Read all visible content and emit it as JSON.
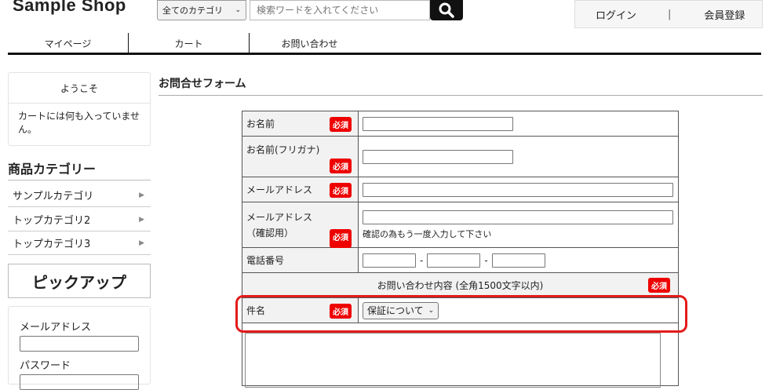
{
  "header": {
    "logo": "Sample Shop",
    "category_select": "全てのカテゴリ",
    "search_placeholder": "検索ワードを入れてください",
    "login": "ログイン",
    "separator": "|",
    "register": "会員登録"
  },
  "nav": [
    "マイページ",
    "カート",
    "お問い合わせ"
  ],
  "sidebar": {
    "welcome_title": "ようこそ",
    "cart_message": "カートには何も入っていません。",
    "category_heading": "商品カテゴリー",
    "categories": [
      "サンプルカテゴリ",
      "トップカテゴリ2",
      "トップカテゴリ3"
    ],
    "pickup": "ピックアップ",
    "email_label": "メールアドレス",
    "password_label": "パスワード"
  },
  "form": {
    "title": "お問合せフォーム",
    "required_label": "必須",
    "name_label": "お名前",
    "kana_label": "お名前(フリガナ)",
    "email_label": "メールアドレス",
    "email_confirm_label_1": "メールアドレス",
    "email_confirm_label_2": "（確認用）",
    "email_confirm_note": "確認の為もう一度入力して下さい",
    "phone_label": "電話番号",
    "phone_sep": "-",
    "contents_label": "お問い合わせ内容 (全角1500文字以内)",
    "subject_label": "件名",
    "subject_value": "保証について"
  },
  "colors": {
    "required": "#e00000",
    "highlight": "#e31b1b"
  }
}
